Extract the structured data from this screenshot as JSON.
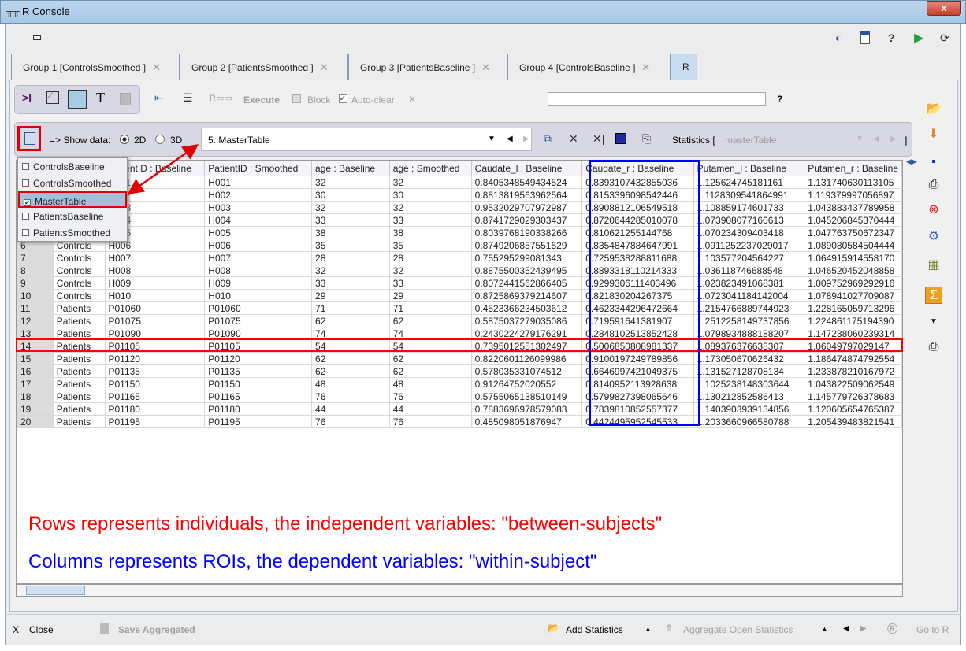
{
  "window": {
    "title": "R Console",
    "close": "x"
  },
  "top_icons": [
    "record-icon",
    "document-icon",
    "help-icon",
    "run-icon",
    "refresh-icon"
  ],
  "tabs": [
    {
      "label": "Group 1 [ControlsSmoothed ]"
    },
    {
      "label": "Group 2 [PatientsSmoothed ]"
    },
    {
      "label": "Group 3 [PatientsBaseline ]"
    },
    {
      "label": "Group 4 [ControlsBaseline ]"
    },
    {
      "label": "R"
    }
  ],
  "toolbar": {
    "execute": "Execute",
    "block": "Block",
    "auto_clear": "Auto-clear",
    "auto_clear_checked": true,
    "help": "?",
    "search_value": ""
  },
  "databar": {
    "show_data": "=> Show data:",
    "opt_2d": "2D",
    "opt_3d": "3D",
    "selected": "2D",
    "table": "5. MasterTable",
    "statistics": "Statistics [",
    "statistics_value": "masterTable",
    "statistics_end": "]"
  },
  "popup": [
    {
      "label": "ControlsBaseline",
      "checked": false
    },
    {
      "label": "ControlsSmoothed",
      "checked": false
    },
    {
      "label": "MasterTable",
      "checked": true
    },
    {
      "label": "PatientsBaseline",
      "checked": false
    },
    {
      "label": "PatientsSmoothed",
      "checked": false
    }
  ],
  "table": {
    "columns": [
      "",
      "",
      "PatientID : Baseline",
      "PatientID : Smoothed",
      "age : Baseline",
      "age : Smoothed",
      "Caudate_l : Baseline",
      "Caudate_r : Baseline",
      "Putamen_l : Baseline",
      "Putamen_r : Baseline"
    ],
    "rows": [
      [
        "1",
        "Controls",
        "H001",
        "H001",
        "32",
        "32",
        "0.8405348549434524",
        "0.8393107432855036",
        "1.125624745181161",
        "1.131740630113105"
      ],
      [
        "2",
        "Controls",
        "H002",
        "H002",
        "30",
        "30",
        "0.8813819563962564",
        "0.8153396098542446",
        "1.1128309541864991",
        "1.119379997056897"
      ],
      [
        "3",
        "Controls",
        "H003",
        "H003",
        "32",
        "32",
        "0.9532029707972987",
        "0.8908812106549518",
        "1.108859174601733",
        "1.043883437789958"
      ],
      [
        "4",
        "Controls",
        "H004",
        "H004",
        "33",
        "33",
        "0.8741729029303437",
        "0.8720644285010078",
        "1.073908077160613",
        "1.045206845370444"
      ],
      [
        "5",
        "Controls",
        "H005",
        "H005",
        "38",
        "38",
        "0.8039768190338266",
        "0.810621255144768",
        "1.070234309403418",
        "1.047763750672347"
      ],
      [
        "6",
        "Controls",
        "H006",
        "H006",
        "35",
        "35",
        "0.8749206857551529",
        "0.8354847884647991",
        "1.0911252237029017",
        "1.089080584504444"
      ],
      [
        "7",
        "Controls",
        "H007",
        "H007",
        "28",
        "28",
        "0.755295299081343",
        "0.7259538288811688",
        "1.103577204564227",
        "1.064915914558170"
      ],
      [
        "8",
        "Controls",
        "H008",
        "H008",
        "32",
        "32",
        "0.8875500352439495",
        "0.8893318110214333",
        "1.036118746688548",
        "1.046520452048858"
      ],
      [
        "9",
        "Controls",
        "H009",
        "H009",
        "33",
        "33",
        "0.8072441562866405",
        "0.9299306111403496",
        "1.023823491068381",
        "1.009752969292916"
      ],
      [
        "10",
        "Controls",
        "H010",
        "H010",
        "29",
        "29",
        "0.8725869379214607",
        "0.821830204267375",
        "1.0723041184142004",
        "1.078941027709087"
      ],
      [
        "11",
        "Patients",
        "P01060",
        "P01060",
        "71",
        "71",
        "0.4523366234503612",
        "0.4623344296472664",
        "1.2154766889744923",
        "1.228165059713296"
      ],
      [
        "12",
        "Patients",
        "P01075",
        "P01075",
        "62",
        "62",
        "0.5875037279035086",
        "0.719591641381907",
        "1.2512258149737856",
        "1.224861175194390"
      ],
      [
        "13",
        "Patients",
        "P01090",
        "P01090",
        "74",
        "74",
        "0.2430224279176291",
        "0.2848102513852428",
        "1.0798934888188207",
        "1.147238060239314"
      ],
      [
        "14",
        "Patients",
        "P01105",
        "P01105",
        "54",
        "54",
        "0.7395012551302497",
        "0.5006850808981337",
        "1.089376376638307",
        "1.06049797029147"
      ],
      [
        "15",
        "Patients",
        "P01120",
        "P01120",
        "62",
        "62",
        "0.8220601126099986",
        "0.9100197249789856",
        "1.173050670626432",
        "1.186474874792554"
      ],
      [
        "16",
        "Patients",
        "P01135",
        "P01135",
        "62",
        "62",
        "0.578035331074512",
        "0.6646997421049375",
        "1.131527128708134",
        "1.233878210167972"
      ],
      [
        "17",
        "Patients",
        "P01150",
        "P01150",
        "48",
        "48",
        "0.91264752020552",
        "0.8140952113928638",
        "1.1025238148303644",
        "1.043822509062549"
      ],
      [
        "18",
        "Patients",
        "P01165",
        "P01165",
        "76",
        "76",
        "0.5755065138510149",
        "0.5799827398065646",
        "1.130212852586413",
        "1.145779726378683"
      ],
      [
        "19",
        "Patients",
        "P01180",
        "P01180",
        "44",
        "44",
        "0.7883696978579083",
        "0.7839810852557377",
        "1.1403903939134856",
        "1.120605654765387"
      ],
      [
        "20",
        "Patients",
        "P01195",
        "P01195",
        "76",
        "76",
        "0.485098051876947",
        "0.4424495952545533",
        "1.2033660966580788",
        "1.205439483821541"
      ]
    ]
  },
  "annotations": {
    "rows": "Rows represents individuals, the independent variables: \"between-subjects\"",
    "columns": "Columns represents ROIs, the dependent variables: \"within-subject\"",
    "rows_color": "#ff0000",
    "columns_color": "#0000ff"
  },
  "bottom": {
    "close": "Close",
    "save_aggregated": "Save Aggregated",
    "add_statistics": "Add Statistics",
    "aggregate_open": "Aggregate Open Statistics",
    "go_to_r": "Go to R"
  }
}
